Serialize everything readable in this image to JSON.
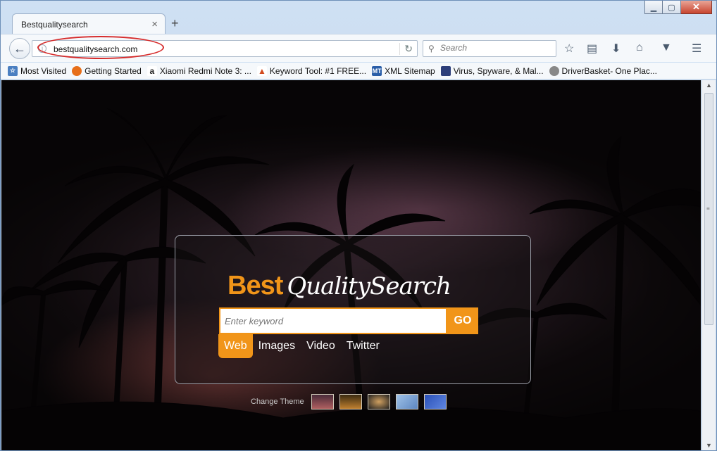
{
  "tab": {
    "title": "Bestqualitysearch",
    "close": "×",
    "new_tab": "+"
  },
  "window_controls": {
    "minimize": "▁",
    "maximize": "▢",
    "close": "✕"
  },
  "nav": {
    "url": "bestqualitysearch.com",
    "search_placeholder": "Search",
    "icons": [
      "back-icon",
      "info-icon",
      "reload-icon",
      "search-icon",
      "bookmark-star-icon",
      "reading-list-icon",
      "download-icon",
      "home-icon",
      "pocket-icon",
      "menu-icon"
    ]
  },
  "bookmarks": [
    {
      "label": "Most Visited",
      "icon": "most-visited-icon",
      "color": "#4a7fc1"
    },
    {
      "label": "Getting Started",
      "icon": "firefox-icon",
      "color": "#e76f1a"
    },
    {
      "label": "Xiaomi Redmi Note 3: ...",
      "icon": "amazon-icon",
      "color": "#222222"
    },
    {
      "label": "Keyword Tool: #1 FREE...",
      "icon": "flame-icon",
      "color": "#d24a1e"
    },
    {
      "label": "XML Sitemap",
      "icon": "mt-icon",
      "color": "#2a5ea8"
    },
    {
      "label": "Virus, Spyware, & Mal...",
      "icon": "shield-icon",
      "color": "#2c3e7a"
    },
    {
      "label": "DriverBasket- One Plac...",
      "icon": "globe-icon",
      "color": "#666666"
    }
  ],
  "page": {
    "logo_best": "Best",
    "logo_rest": "QualitySearch",
    "keyword_placeholder": "Enter keyword",
    "go_label": "GO",
    "search_tabs": [
      "Web",
      "Images",
      "Video",
      "Twitter"
    ],
    "change_theme_label": "Change Theme",
    "accent_color": "#f19519"
  }
}
